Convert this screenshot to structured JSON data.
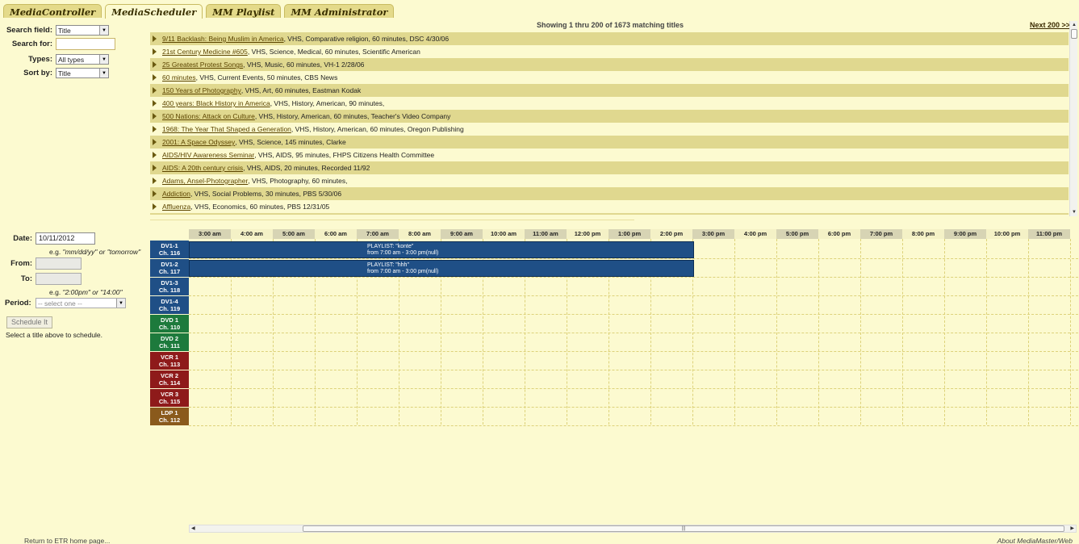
{
  "tabs": [
    {
      "label": "MediaController"
    },
    {
      "label": "MediaScheduler"
    },
    {
      "label": "MM Playlist"
    },
    {
      "label": "MM Administrator"
    }
  ],
  "search": {
    "field_label": "Search field:",
    "field_value": "Title",
    "for_label": "Search for:",
    "for_value": "",
    "types_label": "Types:",
    "types_value": "All types",
    "sort_label": "Sort by:",
    "sort_value": "Title"
  },
  "results": {
    "showing": "Showing 1 thru 200 of 1673 matching titles",
    "next": "Next 200 >>",
    "items": [
      {
        "title": "9/11 Backlash: Being Muslim in America",
        "details": ", VHS, Comparative religion, 60 minutes, DSC 4/30/06"
      },
      {
        "title": "21st Century Medicine #605",
        "details": ", VHS, Science, Medical, 60 minutes, Scientific American"
      },
      {
        "title": "25 Greatest Protest Songs",
        "details": ", VHS, Music, 60 minutes, VH-1 2/28/06"
      },
      {
        "title": "60 minutes",
        "details": ", VHS, Current Events, 50 minutes, CBS News"
      },
      {
        "title": "150 Years of Photography",
        "details": ", VHS, Art, 60 minutes, Eastman Kodak"
      },
      {
        "title": "400 years: Black History in America",
        "details": ", VHS, History, American, 90 minutes,"
      },
      {
        "title": "500 Nations: Attack on Culture",
        "details": ", VHS, History, American, 60 minutes, Teacher's Video Company"
      },
      {
        "title": "1968: The Year That Shaped a Generation",
        "details": ", VHS, History, American, 60 minutes, Oregon Publishing"
      },
      {
        "title": "2001: A Space Odyssey",
        "details": ", VHS, Science, 145 minutes, Clarke"
      },
      {
        "title": "AIDS/HIV Awareness Seminar",
        "details": ", VHS, AIDS, 95 minutes, FHPS Citizens Health Committee"
      },
      {
        "title": "AIDS: A 20th century crisis",
        "details": ", VHS, AIDS, 20 minutes, Recorded 11/92"
      },
      {
        "title": "Adams, Ansel-Photographer",
        "details": ", VHS, Photography, 60 minutes,"
      },
      {
        "title": "Addiction",
        "details": ", VHS, Social Problems, 30 minutes, PBS 5/30/06"
      },
      {
        "title": "Affluenza",
        "details": ", VHS, Economics, 60 minutes, PBS 12/31/05"
      }
    ]
  },
  "schedule_form": {
    "date_label": "Date:",
    "date_value": "10/11/2012",
    "date_hint_prefix": "e.g. ",
    "date_hint_example": "\"mm/dd/yy\" or \"tomorrow\"",
    "from_label": "From:",
    "to_label": "To:",
    "time_hint_prefix": "e.g. ",
    "time_hint_example": "\"2:00pm\" or \"14:00\"",
    "period_label": "Period:",
    "period_value": "-- select one --",
    "schedule_button": "Schedule It",
    "status": "Select a title above to schedule."
  },
  "times": [
    "3:00 am",
    "4:00 am",
    "5:00 am",
    "6:00 am",
    "7:00 am",
    "8:00 am",
    "9:00 am",
    "10:00 am",
    "11:00 am",
    "12:00 pm",
    "1:00 pm",
    "2:00 pm",
    "3:00 pm",
    "4:00 pm",
    "5:00 pm",
    "6:00 pm",
    "7:00 pm",
    "8:00 pm",
    "9:00 pm",
    "10:00 pm",
    "11:00 pm"
  ],
  "channels": [
    {
      "name": "DV1-1",
      "ch": "Ch. 116",
      "color": "#1f4f86"
    },
    {
      "name": "DV1-2",
      "ch": "Ch. 117",
      "color": "#1f4f86"
    },
    {
      "name": "DV1-3",
      "ch": "Ch. 118",
      "color": "#1f4f86"
    },
    {
      "name": "DV1-4",
      "ch": "Ch. 119",
      "color": "#1f4f86"
    },
    {
      "name": "DVD 1",
      "ch": "Ch. 110",
      "color": "#1d7a3c"
    },
    {
      "name": "DVD 2",
      "ch": "Ch. 111",
      "color": "#1d7a3c"
    },
    {
      "name": "VCR 1",
      "ch": "Ch. 113",
      "color": "#8e1a1a"
    },
    {
      "name": "VCR 2",
      "ch": "Ch. 114",
      "color": "#8e1a1a"
    },
    {
      "name": "VCR 3",
      "ch": "Ch. 115",
      "color": "#8e1a1a"
    },
    {
      "name": "LDP 1",
      "ch": "Ch. 112",
      "color": "#8a5a1c"
    }
  ],
  "events": [
    {
      "line1": "PLAYLIST: \"konte\"",
      "line2": "from 7:00 am - 3:00 pm(null)"
    },
    {
      "line1": "PLAYLIST: \"hhh\"",
      "line2": "from 7:00 am - 3:00 pm(null)"
    }
  ],
  "footer": {
    "left": "Return to ETR home page...",
    "right": "About MediaMaster/Web"
  }
}
